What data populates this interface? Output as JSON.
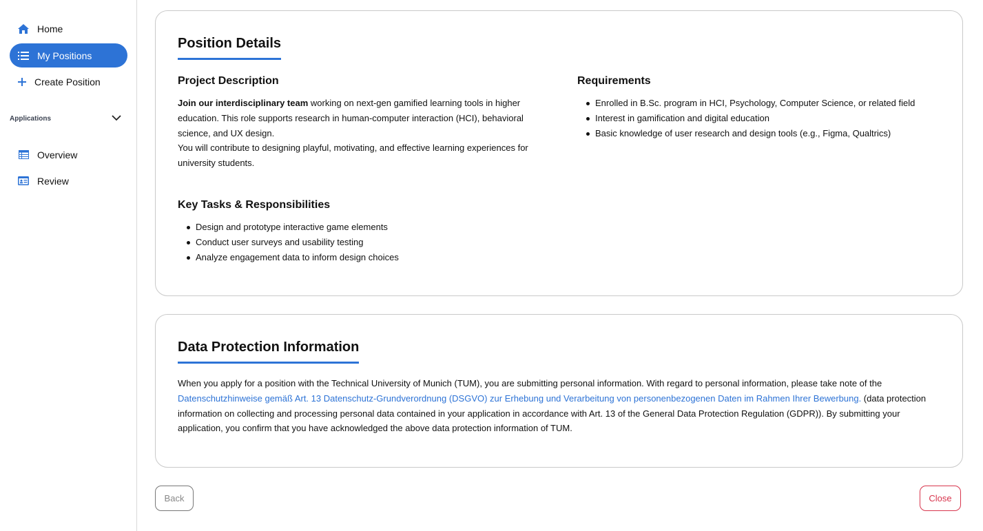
{
  "sidebar": {
    "items": [
      {
        "label": "Home",
        "icon": "home-icon"
      },
      {
        "label": "My Positions",
        "icon": "list-icon",
        "active": true
      },
      {
        "label": "Create Position",
        "icon": "plus-icon"
      }
    ],
    "section_label": "Applications",
    "sub_items": [
      {
        "label": "Overview",
        "icon": "table-icon"
      },
      {
        "label": "Review",
        "icon": "id-card-icon"
      }
    ]
  },
  "position": {
    "title": "Position Details",
    "project_description": {
      "heading": "Project Description",
      "bold_intro": "Join our interdisciplinary team",
      "line1_rest": " working on next-gen gamified learning tools in higher",
      "line2": "education. This role supports research in human-computer interaction (HCI), behavioral",
      "line3": "science, and UX design.",
      "line4": "You will contribute to designing playful, motivating, and effective learning experiences for",
      "line5": "university students."
    },
    "requirements": {
      "heading": "Requirements",
      "items": [
        "Enrolled in B.Sc. program in HCI, Psychology, Computer Science, or related field",
        "Interest in gamification and digital education",
        "Basic knowledge of user research and design tools (e.g., Figma, Qualtrics)"
      ]
    },
    "tasks": {
      "heading": "Key Tasks & Responsibilities",
      "items": [
        "Design and prototype interactive game elements",
        "Conduct user surveys and usability testing",
        "Analyze engagement data to inform design choices"
      ]
    }
  },
  "data_protection": {
    "title": "Data Protection Information",
    "text_before": "When you apply for a position with the Technical University of Munich (TUM), you are submitting personal information. With regard to personal information, please take note of the ",
    "link_text": "Datenschutzhinweise gemäß Art. 13 Datenschutz-Grundverordnung (DSGVO) zur Erhebung und Verarbeitung von personenbezogenen Daten im Rahmen Ihrer Bewerbung.",
    "text_after": " (data protection information on collecting and processing personal data contained in your application in accordance with Art. 13 of the General Data Protection Regulation (GDPR)). By submitting your application, you confirm that you have acknowledged the above data protection information of TUM."
  },
  "buttons": {
    "back": "Back",
    "close": "Close"
  },
  "colors": {
    "accent": "#2d73d6",
    "danger": "#d8354d"
  }
}
